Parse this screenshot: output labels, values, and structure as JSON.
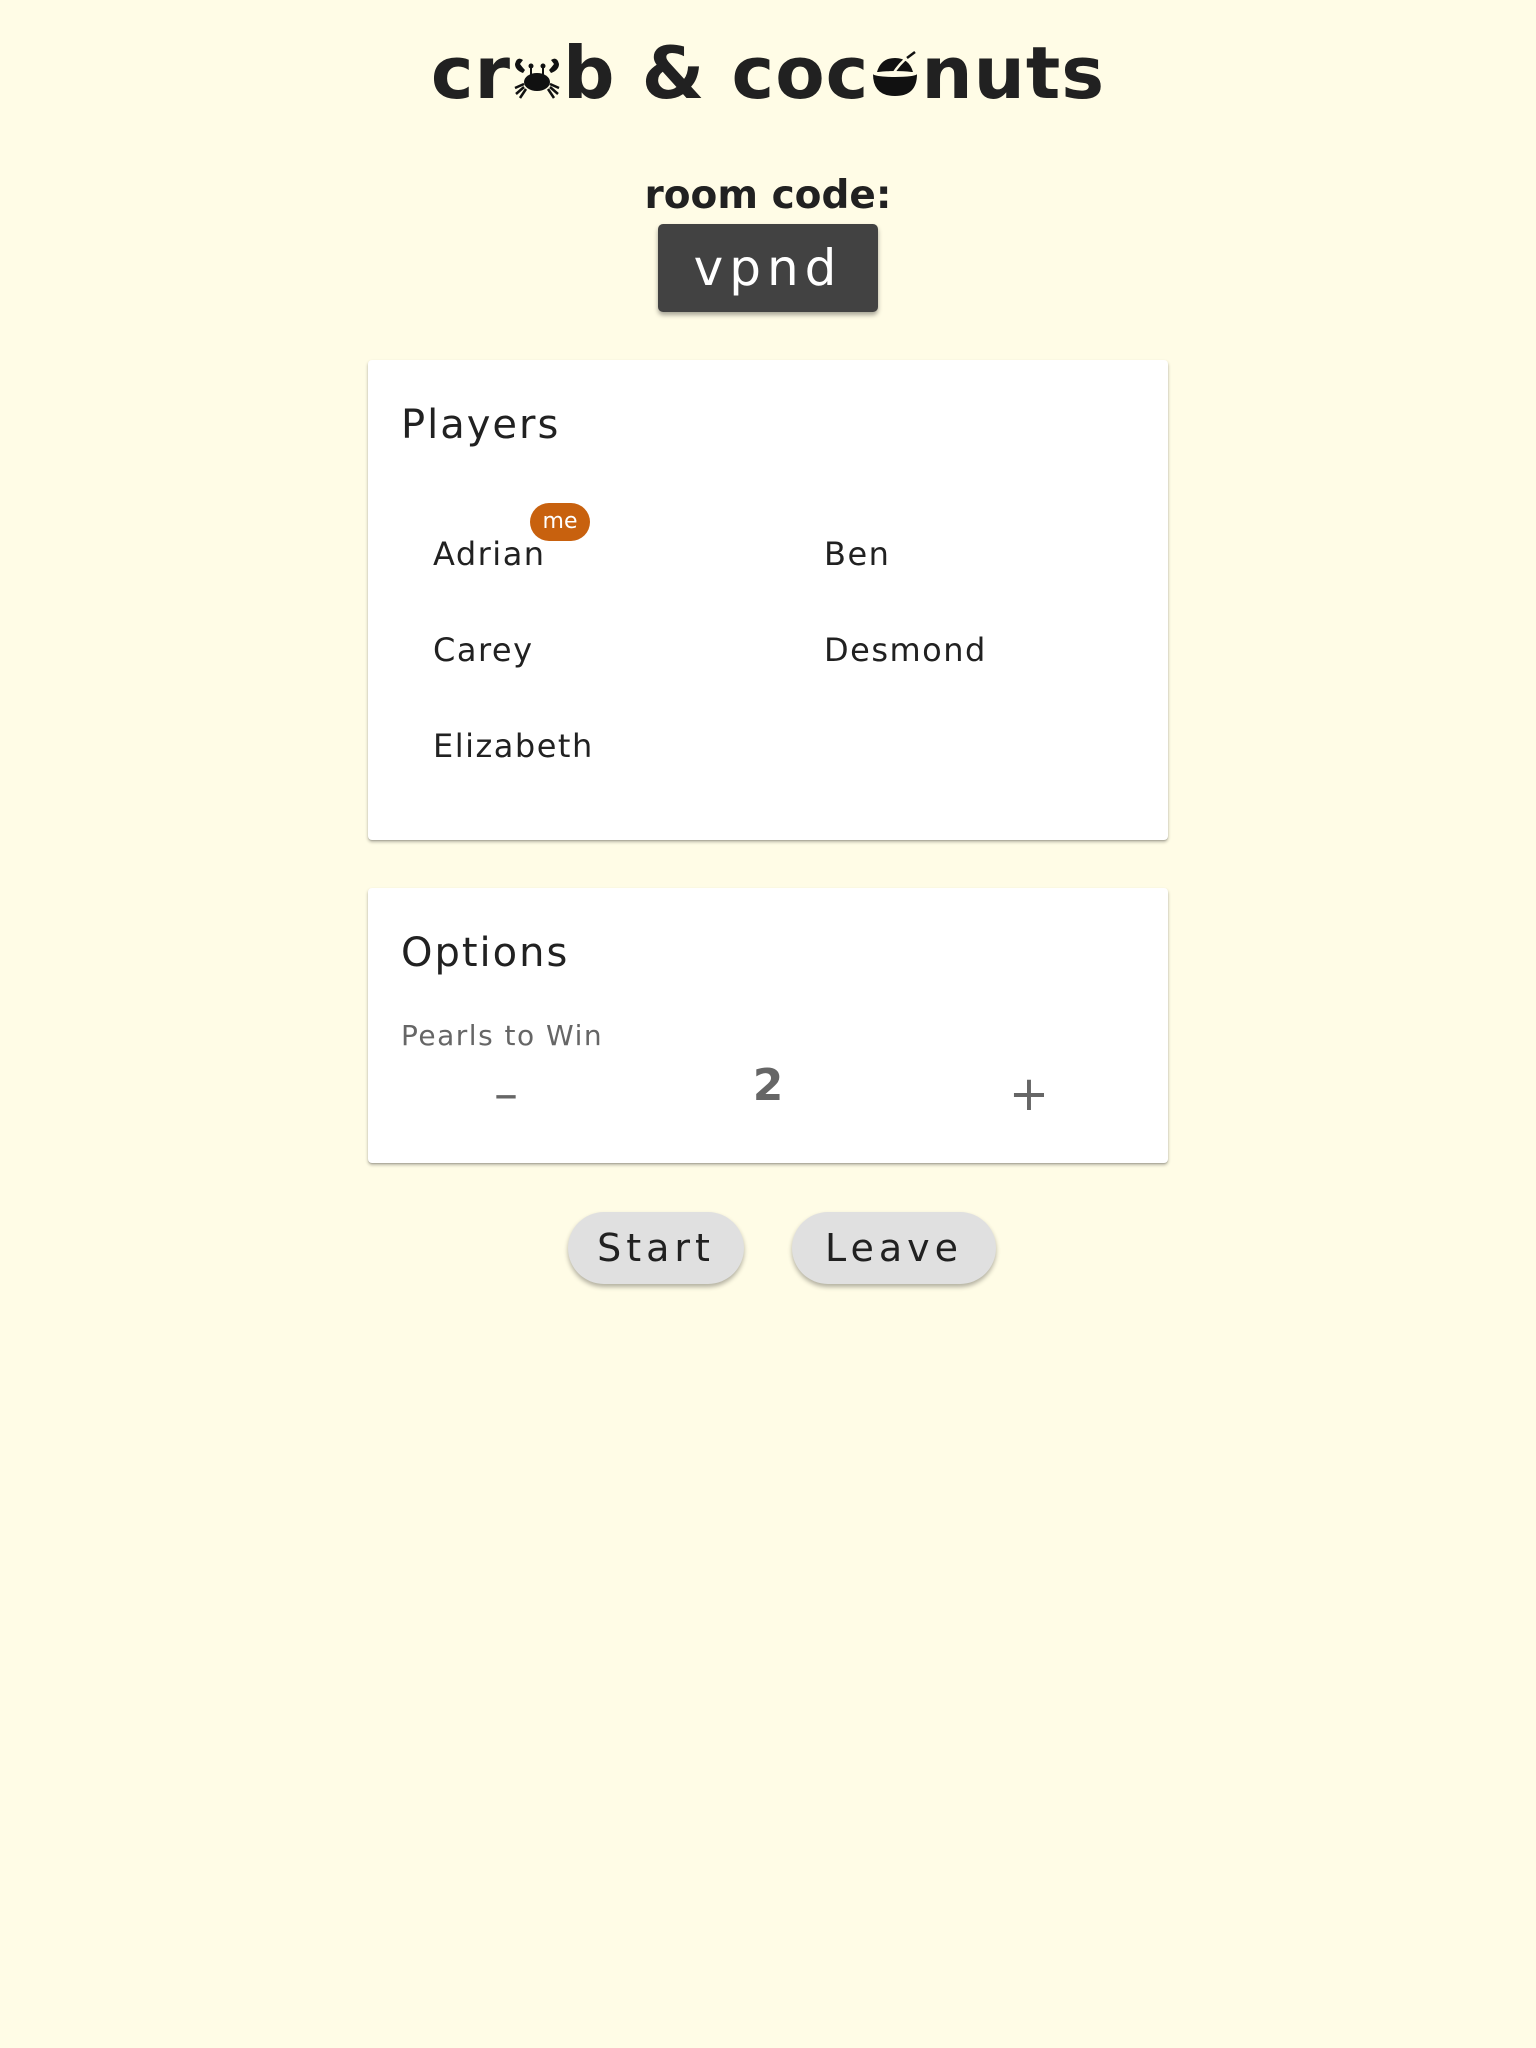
{
  "header": {
    "title_part1": "cr",
    "title_part2": "b & coc",
    "title_part3": "nuts",
    "crab_glyph": "crab-icon",
    "coconut_glyph": "coconut-icon"
  },
  "room": {
    "label": "room code:",
    "code": "vpnd"
  },
  "players_card": {
    "title": "Players",
    "players": [
      "Adrian",
      "Ben",
      "Carey",
      "Desmond",
      "Elizabeth"
    ],
    "me_badge": "me",
    "me_player_index": 0
  },
  "options_card": {
    "title": "Options",
    "pearls_to_win": {
      "label": "Pearls to Win",
      "value": 2,
      "decrement_label": "–",
      "increment_label": "+"
    }
  },
  "actions": {
    "start_label": "Start",
    "leave_label": "Leave"
  },
  "colors": {
    "background": "#fffce6",
    "room_code_bg": "#424242",
    "badge": "#c8610e",
    "button": "#e0e0e0"
  }
}
